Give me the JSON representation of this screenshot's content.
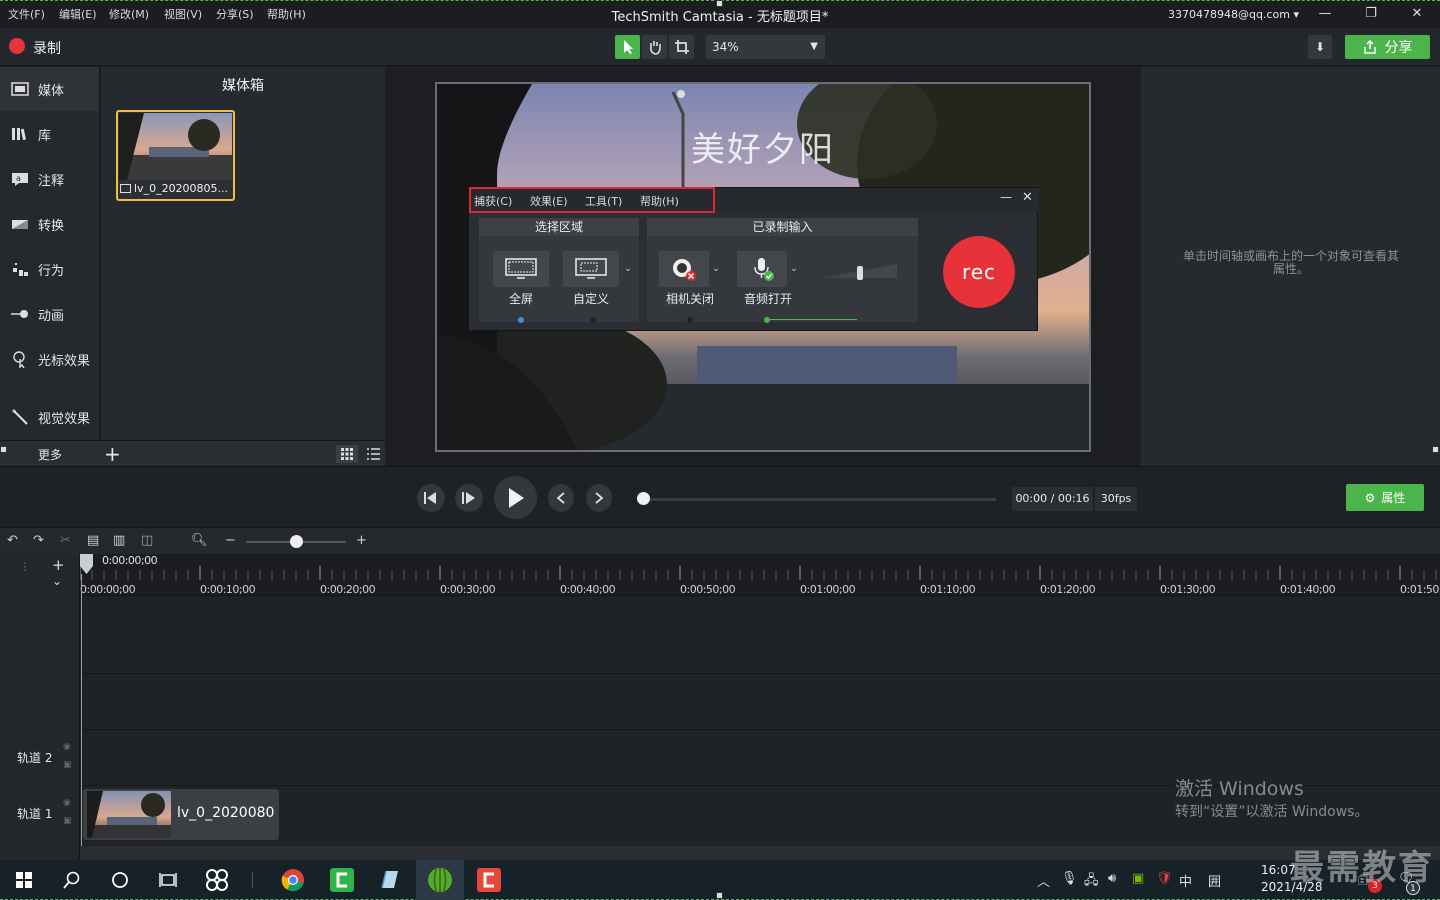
{
  "window": {
    "title": "TechSmith Camtasia - 无标题项目*",
    "account": "3370478948@qq.com",
    "menus": [
      "文件(F)",
      "编辑(E)",
      "修改(M)",
      "视图(V)",
      "分享(S)",
      "帮助(H)"
    ]
  },
  "toolbar": {
    "record_label": "录制",
    "zoom_value": "34%",
    "share_label": "分享"
  },
  "sidebar": {
    "items": [
      {
        "label": "媒体",
        "icon": "media-icon"
      },
      {
        "label": "库",
        "icon": "library-icon"
      },
      {
        "label": "注释",
        "icon": "annotation-icon"
      },
      {
        "label": "转换",
        "icon": "transition-icon"
      },
      {
        "label": "行为",
        "icon": "behavior-icon"
      },
      {
        "label": "动画",
        "icon": "animation-icon"
      },
      {
        "label": "光标效果",
        "icon": "cursor-effect-icon"
      },
      {
        "label": "视觉效果",
        "icon": "visual-effect-icon"
      }
    ],
    "more_label": "更多"
  },
  "media_bin": {
    "title": "媒体箱",
    "items": [
      {
        "name": "lv_0_20200805..."
      }
    ]
  },
  "canvas": {
    "video_title_text": "美好夕阳"
  },
  "recorder": {
    "menus": [
      "捕获(C)",
      "效果(E)",
      "工具(T)",
      "帮助(H)"
    ],
    "select_area_title": "选择区域",
    "fullscreen_label": "全屏",
    "custom_label": "自定义",
    "recorded_input_title": "已录制输入",
    "camera_label": "相机关闭",
    "audio_label": "音频打开",
    "rec_label": "rec"
  },
  "properties": {
    "hint": "单击时间轴或画布上的一个对象可查看其属性。",
    "button_label": "属性"
  },
  "playback": {
    "time": "00:00 / 00:16",
    "fps": "30fps"
  },
  "timeline": {
    "playhead_time": "0:00:00;00",
    "ticks": [
      "0:00:00;00",
      "0:00:10;00",
      "0:00:20;00",
      "0:00:30;00",
      "0:00:40;00",
      "0:00:50;00",
      "0:01:00;00",
      "0:01:10;00",
      "0:01:20;00",
      "0:01:30;00",
      "0:01:40;00",
      "0:01:50;"
    ],
    "tracks": [
      {
        "name": "轨道 2"
      },
      {
        "name": "轨道 1"
      }
    ],
    "clip_label": "lv_0_2020080"
  },
  "watermark": {
    "activate_title": "激活 Windows",
    "activate_sub": "转到“设置”以激活 Windows。",
    "brand": "最需教育"
  },
  "taskbar": {
    "clock_time": "16:07",
    "clock_date": "2021/4/28",
    "ime": "中",
    "notification_count": "3",
    "action_center_count": "1"
  },
  "colors": {
    "accent_green": "#4bb54c",
    "record_red": "#e8343c",
    "selection_yellow": "#f0c040"
  }
}
